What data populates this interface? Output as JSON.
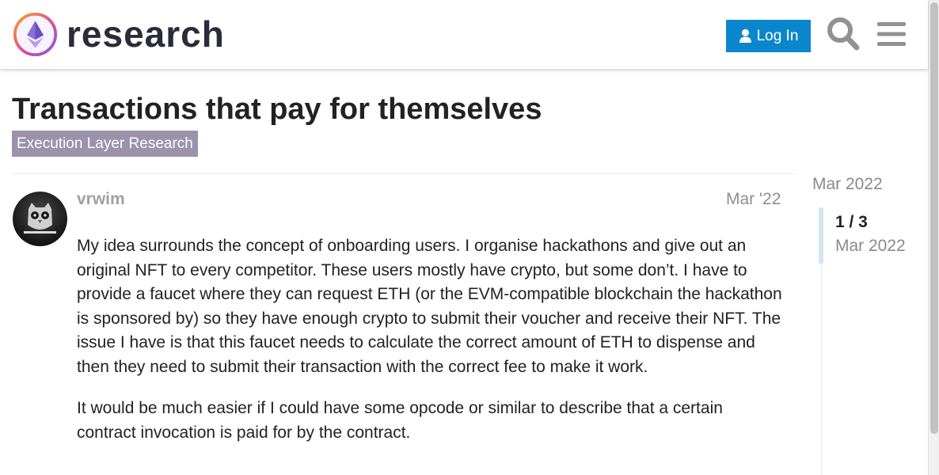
{
  "header": {
    "site_name": "research",
    "login_label": "Log In",
    "brand_color": "#0a87cc",
    "icons": [
      "logo-icon",
      "user-icon",
      "search-icon",
      "hamburger-menu-icon"
    ]
  },
  "topic": {
    "title": "Transactions that pay for themselves",
    "category": "Execution Layer Research",
    "category_color": "#9d92ac"
  },
  "post": {
    "username": "vrwim",
    "date": "Mar '22",
    "paragraphs": [
      "My idea surrounds the concept of onboarding users. I organise hackathons and give out an original NFT to every competitor. These users mostly have crypto, but some don’t. I have to provide a faucet where they can request ETH (or the EVM-compatible blockchain the hackathon is sponsored by) so they have enough crypto to submit their voucher and receive their NFT. The issue I have is that this faucet needs to calculate the correct amount of ETH to dispense and then they need to submit their transaction with the correct fee to make it work.",
      "It would be much easier if I could have some opcode or similar to describe that a certain contract invocation is paid for by the contract."
    ]
  },
  "timeline": {
    "start_date": "Mar 2022",
    "position": "1 / 3",
    "current_date": "Mar 2022"
  }
}
